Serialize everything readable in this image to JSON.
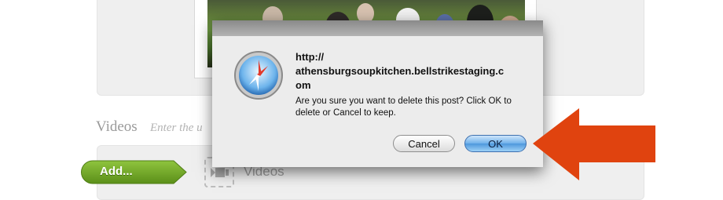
{
  "section": {
    "title": "Videos",
    "hint": "Enter the u"
  },
  "add_button": {
    "label": "Add..."
  },
  "video_drop": {
    "label": "Videos",
    "icon": "video-camera-icon"
  },
  "dialog": {
    "url": "http://athensburgsoupkitchen.bellstrikestaging.com",
    "url_line1": "http://",
    "url_line2": "athensburgsoupkitchen.bellstrikestaging.c",
    "url_line3": "om",
    "message": "Are you sure you want to delete this post? Click OK to delete or Cancel to keep.",
    "cancel_label": "Cancel",
    "ok_label": "OK",
    "icon": "safari-compass-icon"
  },
  "annotation": {
    "icon": "red-arrow-icon",
    "color": "#e0430f"
  },
  "colors": {
    "add_green": "#6ea325",
    "ok_blue": "#4e97dc"
  }
}
